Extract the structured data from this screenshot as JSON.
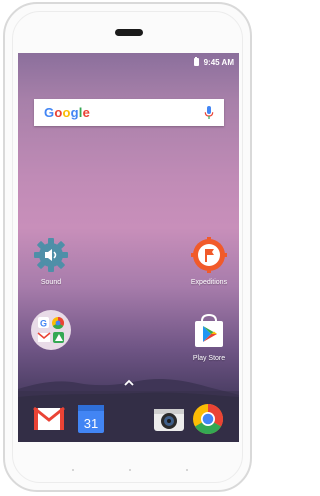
{
  "status_bar": {
    "time": "9:45 AM"
  },
  "search_widget": {
    "logo_letters": [
      "G",
      "o",
      "o",
      "g",
      "l",
      "e"
    ]
  },
  "home_apps": [
    {
      "name": "Sound"
    },
    {
      "name": "Expeditions"
    },
    {
      "name": ""
    },
    {
      "name": "Play Store"
    }
  ],
  "dock": {
    "calendar_day": "31",
    "apps": [
      "Gmail",
      "Calendar",
      "Camera",
      "Chrome"
    ]
  },
  "colors": {
    "google_blue": "#4285f4",
    "google_red": "#ea4335",
    "google_yellow": "#fbbc05",
    "google_green": "#34a853",
    "settings_gear": "#4f8fa8",
    "expeditions": "#f15a2a"
  }
}
